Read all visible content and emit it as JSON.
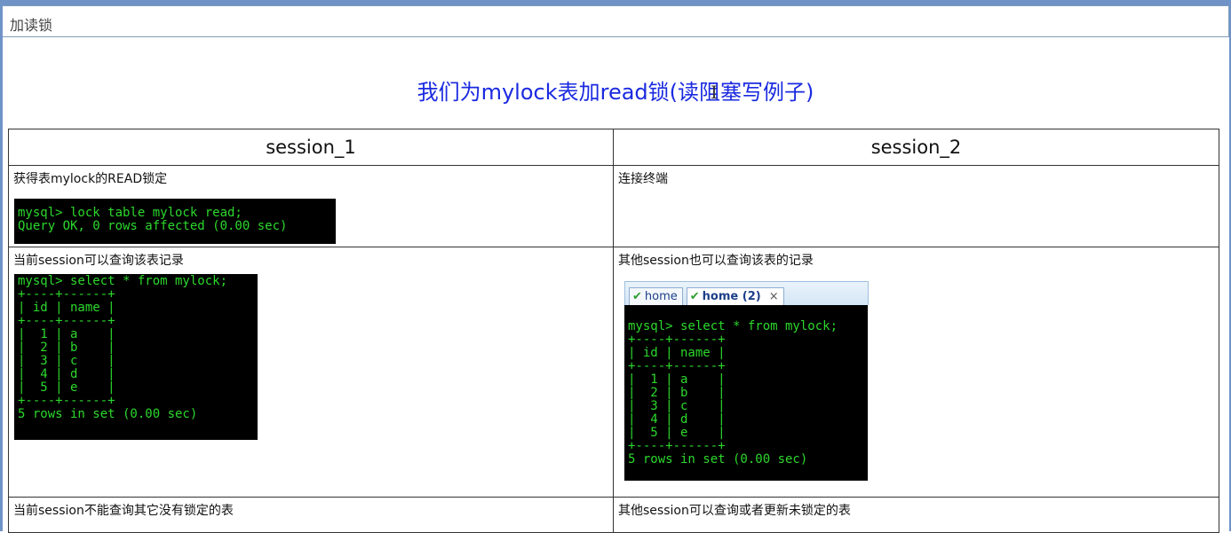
{
  "section": {
    "title": "加读锁"
  },
  "heading": "我们为mylock表加read锁(读阻塞写例子)",
  "table": {
    "headers": [
      "session_1",
      "session_2"
    ],
    "rows": [
      {
        "left": {
          "label": "获得表mylock的READ锁定",
          "terminal": "mysql> lock table mylock read;\nQuery OK, 0 rows affected (0.00 sec)"
        },
        "right": {
          "label": "连接终端"
        }
      },
      {
        "left": {
          "label": "当前session可以查询该表记录",
          "terminal": "mysql> select * from mylock;\n+----+------+\n| id | name |\n+----+------+\n|  1 | a    |\n|  2 | b    |\n|  3 | c    |\n|  4 | d    |\n|  5 | e    |\n+----+------+\n5 rows in set (0.00 sec)"
        },
        "right": {
          "label": "其他session也可以查询该表的记录",
          "tabs": [
            {
              "label": "home",
              "icon": "check-icon"
            },
            {
              "label": "home (2)",
              "icon": "check-icon",
              "close": "×"
            }
          ],
          "terminal": "mysql> select * from mylock;\n+----+------+\n| id | name |\n+----+------+\n|  1 | a    |\n|  2 | b    |\n|  3 | c    |\n|  4 | d    |\n|  5 | e    |\n+----+------+\n5 rows in set (0.00 sec)"
        }
      },
      {
        "left": {
          "label": "当前session不能查询其它没有锁定的表"
        },
        "right": {
          "label": "其他session可以查询或者更新未锁定的表"
        }
      }
    ]
  },
  "colors": {
    "heading": "#1a2ae0",
    "terminal_bg": "#000000",
    "terminal_fg": "#2cd82c",
    "frame": "#6f93c7"
  }
}
